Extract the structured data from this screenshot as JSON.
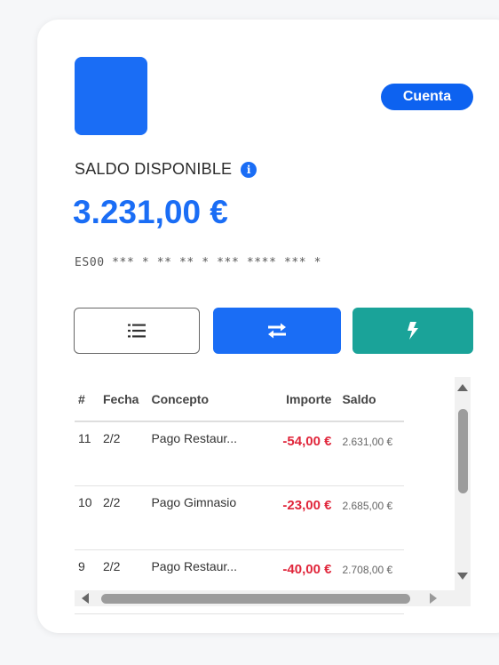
{
  "account": {
    "badge": "Cuenta",
    "balance_label": "SALDO DISPONIBLE",
    "balance_amount": "3.231,00 €",
    "iban_masked": "ES00 *** * ** ** * *** **** *** *",
    "brand_color": "#1a6df5",
    "transfer_color": "#1a6df5",
    "flash_color": "#1aa399"
  },
  "actions": {
    "list_icon": "list-icon",
    "transfer_icon": "transfer-arrows-icon",
    "flash_icon": "lightning-icon"
  },
  "table": {
    "headers": [
      "#",
      "Fecha",
      "Concepto",
      "Importe",
      "Saldo"
    ],
    "rows": [
      {
        "num": "11",
        "fecha": "2/2",
        "concepto": "Pago Restaur...",
        "importe": "-54,00 €",
        "saldo": "2.631,00 €"
      },
      {
        "num": "10",
        "fecha": "2/2",
        "concepto": "Pago Gimnasio",
        "importe": "-23,00 €",
        "saldo": "2.685,00 €"
      },
      {
        "num": "9",
        "fecha": "2/2",
        "concepto": "Pago Restaur...",
        "importe": "-40,00 €",
        "saldo": "2.708,00 €"
      }
    ]
  }
}
